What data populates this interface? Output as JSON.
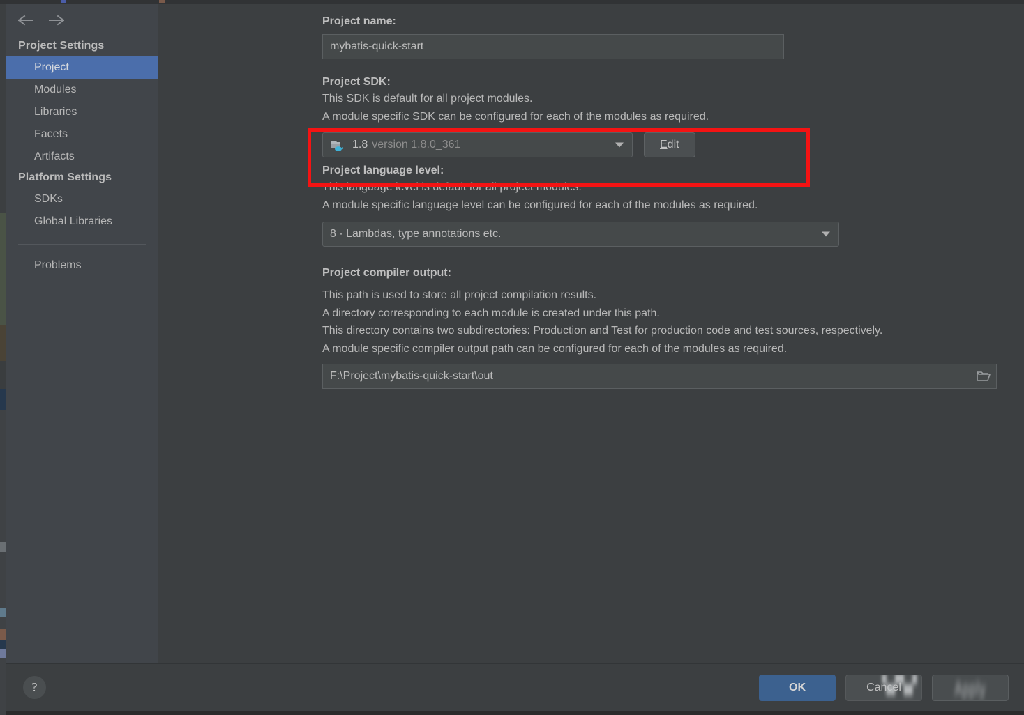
{
  "sidebar": {
    "back_icon": "arrow-left-icon",
    "forward_icon": "arrow-right-icon",
    "groups": [
      {
        "title": "Project Settings",
        "items": [
          {
            "label": "Project",
            "selected": true
          },
          {
            "label": "Modules",
            "selected": false
          },
          {
            "label": "Libraries",
            "selected": false
          },
          {
            "label": "Facets",
            "selected": false
          },
          {
            "label": "Artifacts",
            "selected": false
          }
        ]
      },
      {
        "title": "Platform Settings",
        "items": [
          {
            "label": "SDKs",
            "selected": false
          },
          {
            "label": "Global Libraries",
            "selected": false
          }
        ]
      }
    ],
    "extra_items": [
      {
        "label": "Problems"
      }
    ]
  },
  "content": {
    "project_name": {
      "label": "Project name:",
      "value": "mybatis-quick-start"
    },
    "project_sdk": {
      "label": "Project SDK:",
      "descriptions": [
        "This SDK is default for all project modules.",
        "A module specific SDK can be configured for each of the modules as required."
      ],
      "icon": "java-sdk-folder-icon",
      "name": "1.8",
      "version": "version 1.8.0_361",
      "edit_button": {
        "mnemonic": "E",
        "rest": "dit"
      }
    },
    "language_level": {
      "label": "Project language level:",
      "descriptions": [
        "This language level is default for all project modules.",
        "A module specific language level can be configured for each of the modules as required."
      ],
      "value": "8 - Lambdas, type annotations etc."
    },
    "compiler_output": {
      "label": "Project compiler output:",
      "descriptions": [
        "This path is used to store all project compilation results.",
        "A directory corresponding to each module is created under this path.",
        "This directory contains two subdirectories: Production and Test for production code and test sources, respectively.",
        "A module specific compiler output path can be configured for each of the modules as required."
      ],
      "value": "F:\\Project\\mybatis-quick-start\\out",
      "browse_icon": "open-folder-icon"
    }
  },
  "annotation": {
    "color": "#f41313",
    "target": "project-sdk-row"
  },
  "footer": {
    "help_label": "?",
    "ok_label": "OK",
    "cancel_label": "Cancel",
    "apply_label": "Apply"
  },
  "theme": {
    "dialog_bg": "#3c3f41",
    "sidebar_bg": "#41454a",
    "selection_blue": "#4b6eab",
    "primary_button_blue": "#3c618f",
    "field_bg": "#45494a",
    "text_primary": "#bfbfbf",
    "text_secondary": "#8d8d8d",
    "java_badge_blue": "#3fb3d8"
  }
}
